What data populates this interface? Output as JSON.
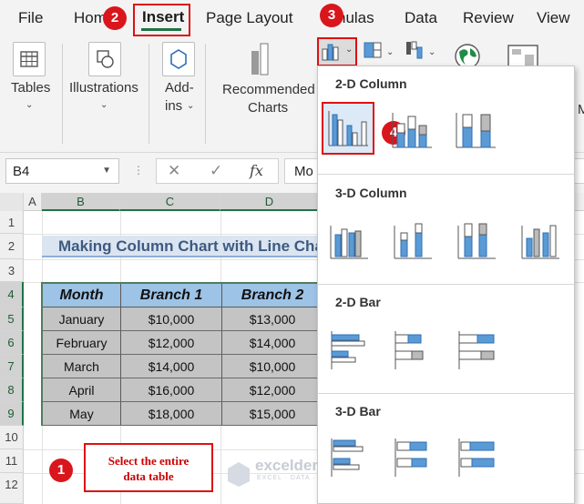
{
  "tabs": [
    "File",
    "Home",
    "Insert",
    "Page Layout",
    "Formulas",
    "Data",
    "Review",
    "View"
  ],
  "tab_display": {
    "file": "File",
    "home_partial": "Hom",
    "insert": "Insert",
    "page_layout": "Page Layout",
    "formulas_partial": "nulas",
    "data": "Data",
    "review": "Review",
    "view": "View"
  },
  "steps": {
    "one": "1",
    "two": "2",
    "three": "3",
    "four": "4"
  },
  "ribbon": {
    "tables": "Tables",
    "illustrations": "Illustrations",
    "addins_line1": "Add-",
    "addins_line2": "ins",
    "recommended_line1": "Recommended",
    "recommended_line2": "Charts",
    "partial_m": "M"
  },
  "formula_bar": {
    "name_box": "B4",
    "dots": "⋮",
    "cancel": "✕",
    "enter": "✓",
    "fx": "fx",
    "content": "Mo"
  },
  "grid": {
    "columns": [
      "A",
      "B",
      "C",
      "D"
    ],
    "rows": [
      "1",
      "2",
      "3",
      "4",
      "5",
      "6",
      "7",
      "8",
      "9",
      "10",
      "11",
      "12"
    ],
    "title": "Making Column Chart with Line Chart",
    "headers": [
      "Month",
      "Branch 1",
      "Branch 2"
    ],
    "table": [
      [
        "January",
        "$10,000",
        "$13,000"
      ],
      [
        "February",
        "$12,000",
        "$14,000"
      ],
      [
        "March",
        "$14,000",
        "$10,000"
      ],
      [
        "April",
        "$16,000",
        "$12,000"
      ],
      [
        "May",
        "$18,000",
        "$15,000"
      ]
    ],
    "note_line1": "Select the entire",
    "note_line2": "data table"
  },
  "watermark": {
    "name": "exceldemy",
    "tagline": "EXCEL · DATA · BI"
  },
  "dropdown": {
    "section_2d_column": "2-D Column",
    "section_3d_column": "3-D Column",
    "section_2d_bar": "2-D Bar",
    "section_3d_bar": "3-D Bar"
  },
  "colors": {
    "accent_red": "#d11111",
    "excel_green": "#217346",
    "header_blue": "#9dc3e6",
    "title_fill": "#dbe5f1",
    "chart_blue": "#5b9bd5"
  }
}
